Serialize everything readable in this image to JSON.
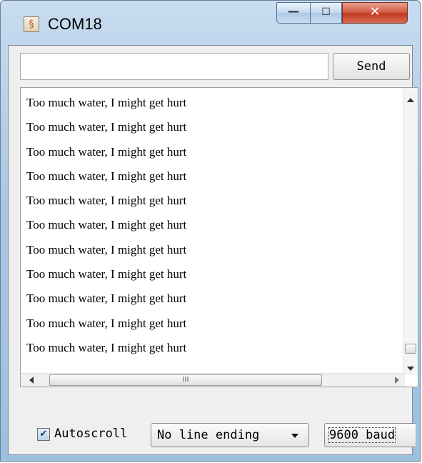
{
  "window": {
    "title": "COM18",
    "title_icon": "arduino-icon",
    "controls": {
      "minimize": "—",
      "maximize": "☐",
      "close": "✕"
    }
  },
  "send": {
    "input_value": "",
    "button_label": "Send"
  },
  "output": {
    "lines": [
      "Too much water, I might get hurt",
      "Too much water, I might get hurt",
      "Too much water, I might get hurt",
      "Too much water, I might get hurt",
      "Too much water, I might get hurt",
      "Too much water, I might get hurt",
      "Too much water, I might get hurt",
      "Too much water, I might get hurt",
      "Too much water, I might get hurt",
      "Too much water, I might get hurt",
      "Too much water, I might get hurt"
    ],
    "hscroll_grip": "III"
  },
  "footer": {
    "autoscroll_label": "Autoscroll",
    "autoscroll_checked": true,
    "line_ending": "No line ending",
    "baud": "9600 baud"
  },
  "colors": {
    "titlebar": "#a9c6e4",
    "close": "#c2391d",
    "panel": "#efefef"
  }
}
